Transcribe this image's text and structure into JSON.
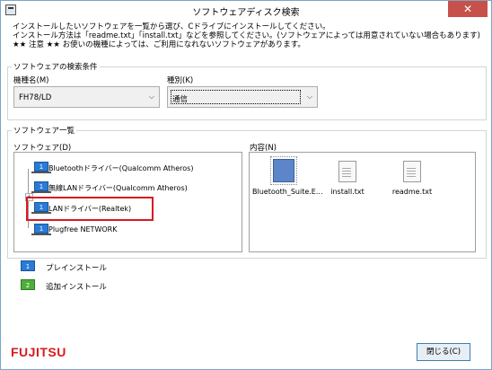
{
  "window": {
    "title": "ソフトウェアディスク検索",
    "close_symbol": "✕"
  },
  "instructions": [
    "インストールしたいソフトウェアを一覧から選び、Cドライブにインストールしてください。",
    "インストール方法は「readme.txt」「install.txt」などを参照してください。(ソフトウェアによっては用意されていない場合もあります)",
    "★★ 注意 ★★ お使いの機種によっては、ご利用になれないソフトウェアがあります。"
  ],
  "search_conditions": {
    "title": "ソフトウェアの検索条件",
    "model_label": "機種名(M)",
    "model_value": "FH78/LD",
    "type_label": "種別(K)",
    "type_value": "通信"
  },
  "software_list": {
    "title": "ソフトウェア一覧",
    "software_label": "ソフトウェア(D)",
    "content_label": "内容(N)",
    "items": [
      {
        "label": "Bluetoothドライバー(Qualcomm Atheros)",
        "icon_text": "1"
      },
      {
        "label": "無線LANドライバー(Qualcomm Atheros)",
        "icon_text": "1"
      },
      {
        "label": "LANドライバー(Realtek)",
        "icon_text": "1"
      },
      {
        "label": "Plugfree NETWORK",
        "icon_text": "1"
      }
    ],
    "expander_symbol": "+",
    "files": [
      {
        "name": "Bluetooth_Suite.E...",
        "icon": "installer-icon"
      },
      {
        "name": "install.txt",
        "icon": "text-file-icon"
      },
      {
        "name": "readme.txt",
        "icon": "text-file-icon"
      }
    ]
  },
  "legend": [
    {
      "label": "プレインストール",
      "icon_text": "1",
      "color": "#2a7bd6"
    },
    {
      "label": "追加インストール",
      "icon_text": "2",
      "color": "#4caf3a"
    }
  ],
  "footer": {
    "logo": "FUJITSU",
    "close_button": "閉じる(C)"
  },
  "colors": {
    "highlight": "#d8191f",
    "accent": "#2a7bd6"
  }
}
